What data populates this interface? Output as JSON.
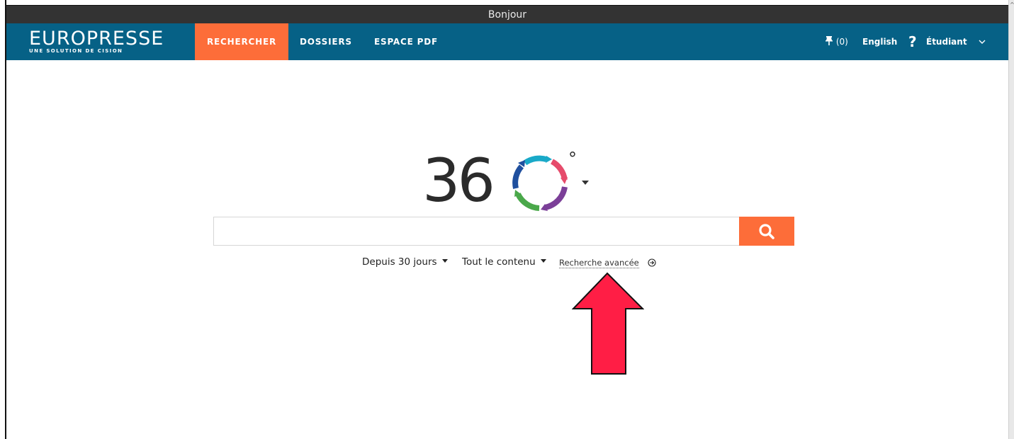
{
  "window": {
    "title": "Bonjour"
  },
  "navbar": {
    "brand": "EUROPRESSE",
    "tagline": "UNE SOLUTION DE CISION",
    "tabs": [
      {
        "label": "RECHERCHER",
        "active": true
      },
      {
        "label": "DOSSIERS",
        "active": false
      },
      {
        "label": "ESPACE PDF",
        "active": false
      }
    ],
    "pin_count": "(0)",
    "language": "English",
    "help": "?",
    "user": "Étudiant",
    "icons": {
      "pin": "pin-icon",
      "user_menu": "chevron-down-icon"
    },
    "colors": {
      "bar": "#066186",
      "active_tab": "#fd6d39"
    }
  },
  "logo360": {
    "digits": "36",
    "degree": "°",
    "ring_colors": [
      "#19a9c8",
      "#e64b6b",
      "#7b3f98",
      "#4aa84a",
      "#1f4f9e"
    ]
  },
  "search": {
    "value": "",
    "placeholder": "",
    "button_icon": "search-icon",
    "button_color": "#fd6d39"
  },
  "filters": {
    "period": "Depuis 30 jours",
    "content": "Tout le contenu",
    "advanced": "Recherche avancée",
    "advanced_icon": "arrow-circle-right-icon"
  },
  "annotation": {
    "arrow_color": "#ff1e45",
    "icon": "arrow-up-icon"
  }
}
